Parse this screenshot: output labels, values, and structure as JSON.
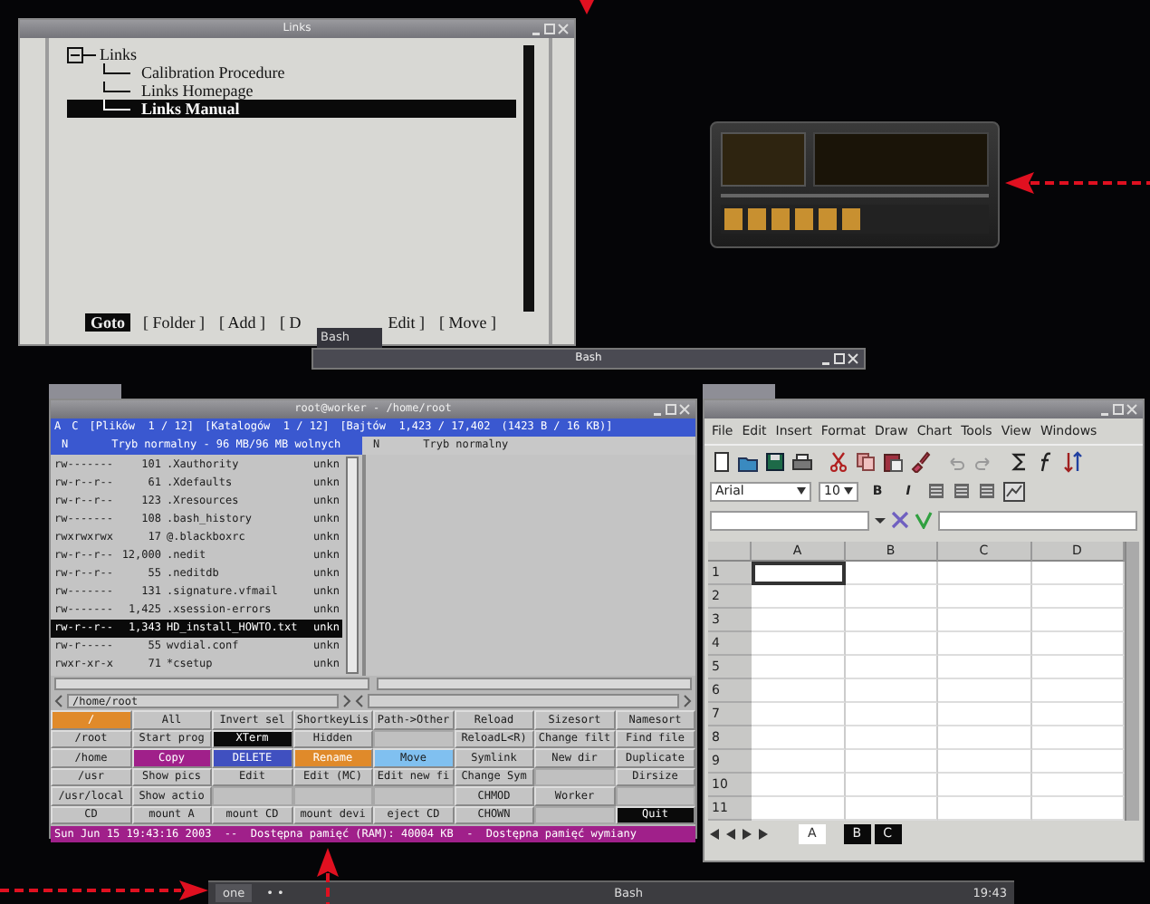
{
  "links_window": {
    "title": "Links",
    "tree": {
      "label": "Links",
      "expanded": true,
      "children": [
        {
          "label": "Calibration Procedure",
          "selected": false
        },
        {
          "label": "Links Homepage",
          "selected": false
        },
        {
          "label": "Links Manual",
          "selected": true
        }
      ]
    },
    "buttons": [
      {
        "label": "Goto",
        "selected": true
      },
      {
        "label": "[ Folder ]",
        "selected": false
      },
      {
        "label": "[ Add ]",
        "selected": false
      },
      {
        "label": "[ D",
        "selected": false
      },
      {
        "label": "Edit ]",
        "selected": false
      },
      {
        "label": "[ Move ]",
        "selected": false
      }
    ]
  },
  "bash_window": {
    "tab": "Bash",
    "title": "Bash"
  },
  "worker_window": {
    "title": "root@worker - /home/root",
    "header": [
      "A",
      "C",
      "[Plików  1 / 12]",
      "[Katalogów  1 / 12]",
      "[Bajtów  1,423 / 17,402",
      "(1423 B / 16 KB)]"
    ],
    "panels": [
      {
        "mode_key": "N",
        "mode": "Tryb normalny - 96 MB/96 MB wolnych",
        "active": true
      },
      {
        "mode_key": "N",
        "mode": "Tryb normalny",
        "active": false
      }
    ],
    "files": [
      {
        "perms": "rw-------",
        "size": "101",
        "name": ".Xauthority",
        "type": "unkn",
        "selected": false
      },
      {
        "perms": "rw-r--r--",
        "size": "61",
        "name": ".Xdefaults",
        "type": "unkn",
        "selected": false
      },
      {
        "perms": "rw-r--r--",
        "size": "123",
        "name": ".Xresources",
        "type": "unkn",
        "selected": false
      },
      {
        "perms": "rw-------",
        "size": "108",
        "name": ".bash_history",
        "type": "unkn",
        "selected": false
      },
      {
        "perms": "rwxrwxrwx",
        "size": "17",
        "name": "@.blackboxrc",
        "type": "unkn",
        "selected": false
      },
      {
        "perms": "rw-r--r--",
        "size": "12,000",
        "name": ".nedit",
        "type": "unkn",
        "selected": false
      },
      {
        "perms": "rw-r--r--",
        "size": "55",
        "name": ".neditdb",
        "type": "unkn",
        "selected": false
      },
      {
        "perms": "rw-------",
        "size": "131",
        "name": ".signature.vfmail",
        "type": "unkn",
        "selected": false
      },
      {
        "perms": "rw-------",
        "size": "1,425",
        "name": ".xsession-errors",
        "type": "unkn",
        "selected": false
      },
      {
        "perms": "rw-r--r--",
        "size": "1,343",
        "name": "HD_install_HOWTO.txt",
        "type": "unkn",
        "selected": true
      },
      {
        "perms": "rw-r-----",
        "size": "55",
        "name": "wvdial.conf",
        "type": "unkn",
        "selected": false
      },
      {
        "perms": "rwxr-xr-x",
        "size": "71",
        "name": "*csetup",
        "type": "unkn",
        "selected": false
      }
    ],
    "path": "/home/root",
    "buttons": [
      [
        {
          "kind": "button",
          "label": "/",
          "color": "#e08a2a"
        },
        {
          "kind": "button",
          "label": "All"
        },
        {
          "kind": "button",
          "label": "Invert sel"
        },
        {
          "kind": "button",
          "label": "ShortkeyLis"
        },
        {
          "kind": "button",
          "label": "Path->Other"
        },
        {
          "kind": "button",
          "label": "Reload"
        },
        {
          "kind": "button",
          "label": "Sizesort"
        },
        {
          "kind": "button",
          "label": "Namesort"
        }
      ],
      [
        {
          "kind": "button",
          "label": "/root"
        },
        {
          "kind": "button",
          "label": "Start prog"
        },
        {
          "kind": "button",
          "label": "XTerm",
          "color": "#0a0a0a"
        },
        {
          "kind": "button",
          "label": "Hidden"
        },
        {
          "kind": "blank"
        },
        {
          "kind": "button",
          "label": "ReloadL<R)"
        },
        {
          "kind": "button",
          "label": "Change filt"
        },
        {
          "kind": "button",
          "label": "Find file"
        }
      ],
      [
        {
          "kind": "button",
          "label": "/home"
        },
        {
          "kind": "button",
          "label": "Copy",
          "color": "#a0208a"
        },
        {
          "kind": "button",
          "label": "DELETE",
          "color": "#4050c0"
        },
        {
          "kind": "button",
          "label": "Rename",
          "color": "#e08a2a"
        },
        {
          "kind": "button",
          "label": "Move",
          "color": "#80c0f0"
        },
        {
          "kind": "button",
          "label": "Symlink"
        },
        {
          "kind": "button",
          "label": "New dir"
        },
        {
          "kind": "button",
          "label": "Duplicate"
        }
      ],
      [
        {
          "kind": "button",
          "label": "/usr"
        },
        {
          "kind": "button",
          "label": "Show pics"
        },
        {
          "kind": "button",
          "label": "Edit"
        },
        {
          "kind": "button",
          "label": "Edit (MC)"
        },
        {
          "kind": "button",
          "label": "Edit new fi"
        },
        {
          "kind": "button",
          "label": "Change Sym"
        },
        {
          "kind": "blank"
        },
        {
          "kind": "button",
          "label": "Dirsize"
        }
      ],
      [
        {
          "kind": "button",
          "label": "/usr/local"
        },
        {
          "kind": "button",
          "label": "Show actio"
        },
        {
          "kind": "blank"
        },
        {
          "kind": "blank"
        },
        {
          "kind": "blank"
        },
        {
          "kind": "button",
          "label": "CHMOD"
        },
        {
          "kind": "button",
          "label": "Worker"
        },
        {
          "kind": "blank"
        }
      ],
      [
        {
          "kind": "button",
          "label": "CD"
        },
        {
          "kind": "button",
          "label": "mount A"
        },
        {
          "kind": "button",
          "label": "mount CD"
        },
        {
          "kind": "button",
          "label": "mount devi"
        },
        {
          "kind": "button",
          "label": "eject CD"
        },
        {
          "kind": "button",
          "label": "CHOWN"
        },
        {
          "kind": "blank"
        },
        {
          "kind": "button",
          "label": "Quit",
          "color": "#0a0a0a"
        }
      ]
    ],
    "status": "Sun Jun 15 19:43:16 2003  --  Dostępna pamięć (RAM): 40004 KB  -  Dostępna pamięć wymiany"
  },
  "spreadsheet": {
    "menu": [
      "File",
      "Edit",
      "Insert",
      "Format",
      "Draw",
      "Chart",
      "Tools",
      "View",
      "Windows"
    ],
    "font": "Arial",
    "size": "10",
    "bold_button": "B",
    "italic_button": "I",
    "columns": [
      "A",
      "B",
      "C",
      "D"
    ],
    "rows": [
      {
        "label": "1",
        "cells": [
          {
            "selected": true
          },
          {
            "selected": false
          },
          {
            "selected": false
          },
          {
            "selected": false
          }
        ]
      },
      {
        "label": "2",
        "cells": [
          {
            "selected": false
          },
          {
            "selected": false
          },
          {
            "selected": false
          },
          {
            "selected": false
          }
        ]
      },
      {
        "label": "3",
        "cells": [
          {
            "selected": false
          },
          {
            "selected": false
          },
          {
            "selected": false
          },
          {
            "selected": false
          }
        ]
      },
      {
        "label": "4",
        "cells": [
          {
            "selected": false
          },
          {
            "selected": false
          },
          {
            "selected": false
          },
          {
            "selected": false
          }
        ]
      },
      {
        "label": "5",
        "cells": [
          {
            "selected": false
          },
          {
            "selected": false
          },
          {
            "selected": false
          },
          {
            "selected": false
          }
        ]
      },
      {
        "label": "6",
        "cells": [
          {
            "selected": false
          },
          {
            "selected": false
          },
          {
            "selected": false
          },
          {
            "selected": false
          }
        ]
      },
      {
        "label": "7",
        "cells": [
          {
            "selected": false
          },
          {
            "selected": false
          },
          {
            "selected": false
          },
          {
            "selected": false
          }
        ]
      },
      {
        "label": "8",
        "cells": [
          {
            "selected": false
          },
          {
            "selected": false
          },
          {
            "selected": false
          },
          {
            "selected": false
          }
        ]
      },
      {
        "label": "9",
        "cells": [
          {
            "selected": false
          },
          {
            "selected": false
          },
          {
            "selected": false
          },
          {
            "selected": false
          }
        ]
      },
      {
        "label": "10",
        "cells": [
          {
            "selected": false
          },
          {
            "selected": false
          },
          {
            "selected": false
          },
          {
            "selected": false
          }
        ]
      },
      {
        "label": "11",
        "cells": [
          {
            "selected": false
          },
          {
            "selected": false
          },
          {
            "selected": false
          },
          {
            "selected": false
          }
        ]
      }
    ],
    "sheets": [
      {
        "label": "A",
        "selected": true
      },
      {
        "label": "B",
        "selected": false
      },
      {
        "label": "C",
        "selected": false
      }
    ]
  },
  "taskbar": {
    "workspace": "one",
    "pager": "• •",
    "task": "Bash",
    "clock": "19:43"
  }
}
